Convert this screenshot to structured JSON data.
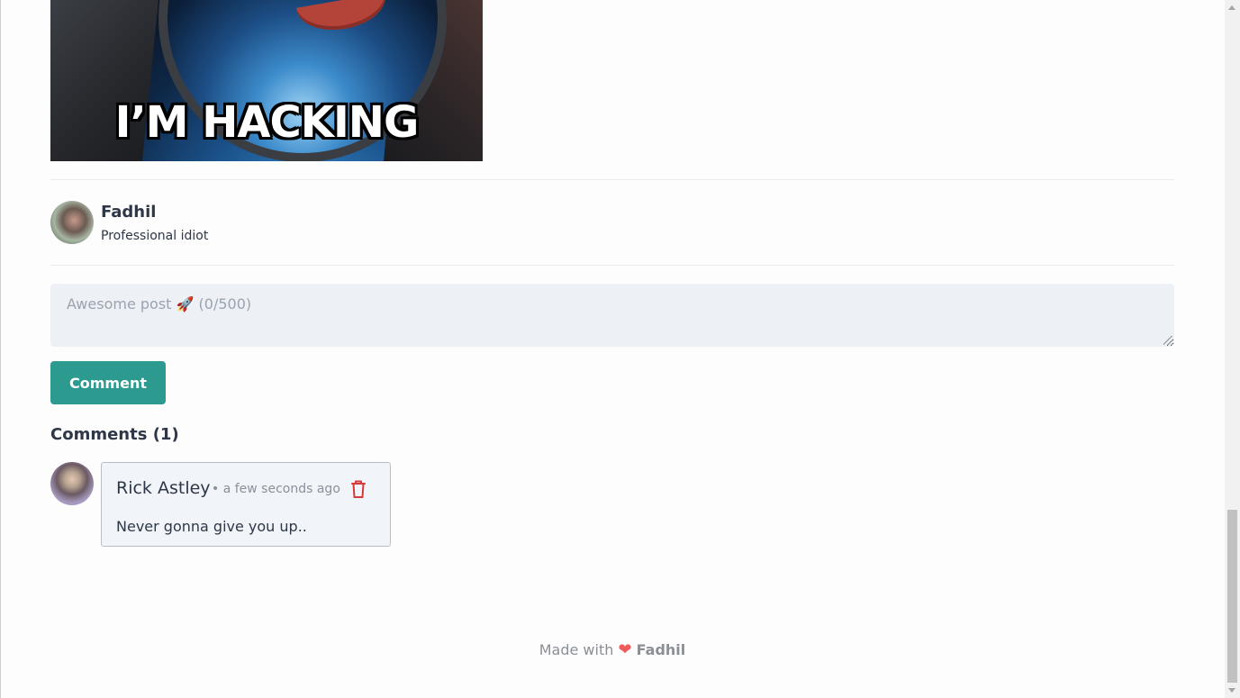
{
  "post": {
    "image_caption": "I’M HACKING",
    "image_alt": "I'm hacking meme"
  },
  "author": {
    "name": "Fadhil",
    "bio": "Professional idiot"
  },
  "comment_form": {
    "placeholder": "Awesome post 🚀 (0/500)",
    "value": "",
    "submit_label": "Comment"
  },
  "comments": {
    "heading": "Comments (1)",
    "items": [
      {
        "author": "Rick Astley",
        "time": "• a few seconds ago",
        "text": "Never gonna give you up.."
      }
    ]
  },
  "footer": {
    "prefix": "Made with",
    "heart": "❤",
    "name": "Fadhil"
  },
  "colors": {
    "accent": "#2c9a8f",
    "delete": "#d63a3a",
    "heart": "#ef5b5b"
  }
}
